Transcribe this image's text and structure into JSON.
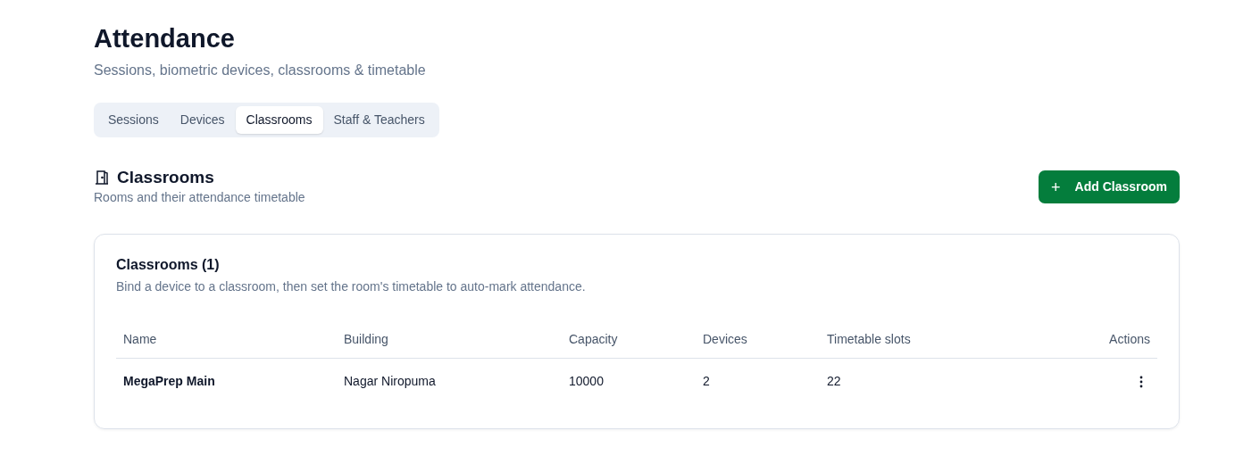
{
  "page": {
    "title": "Attendance",
    "subtitle": "Sessions, biometric devices, classrooms & timetable"
  },
  "tabs": [
    {
      "label": "Sessions",
      "selected": false
    },
    {
      "label": "Devices",
      "selected": false
    },
    {
      "label": "Classrooms",
      "selected": true
    },
    {
      "label": "Staff & Teachers",
      "selected": false
    }
  ],
  "section": {
    "title": "Classrooms",
    "subtitle": "Rooms and their attendance timetable",
    "add_button": {
      "icon": "+",
      "label": "Add Classroom"
    }
  },
  "card": {
    "title": "Classrooms (1)",
    "description": "Bind a device to a classroom, then set the room's timetable to auto-mark attendance."
  },
  "table": {
    "columns": [
      "Name",
      "Building",
      "Capacity",
      "Devices",
      "Timetable slots",
      "Actions"
    ],
    "rows": [
      {
        "cells": [
          "MegaPrep Main",
          "Nagar Niropuma",
          "10000",
          "2",
          "22"
        ]
      }
    ]
  }
}
